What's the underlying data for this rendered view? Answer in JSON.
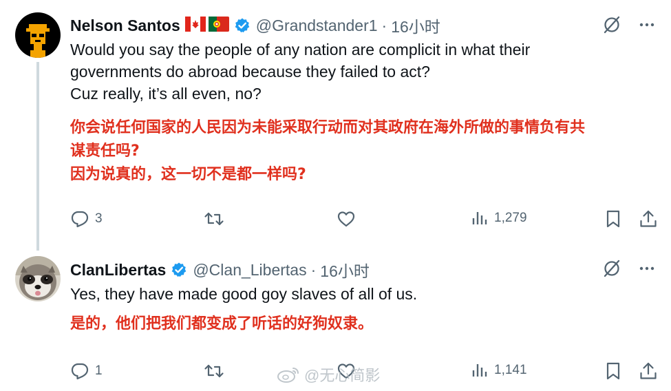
{
  "tweets": [
    {
      "name": "Nelson Santos",
      "handle": "@Grandstander1",
      "separator": "·",
      "time": "16小时",
      "text_lines": [
        "Would you say the people of any nation are complicit in what their",
        "governments do abroad because they failed to act?",
        "Cuz really, it’s all even, no?"
      ],
      "translation_lines": [
        "你会说任何国家的人民因为未能采取行动而对其政府在海外所做的事情负有共",
        "谋责任吗?",
        "因为说真的，这一切不是都一样吗?"
      ],
      "replies": "3",
      "retweets": "",
      "likes": "",
      "views": "1,279"
    },
    {
      "name": "ClanLibertas",
      "handle": "@Clan_Libertas",
      "separator": "·",
      "time": "16小时",
      "text_lines": [
        "Yes, they have made good goy slaves of all of us."
      ],
      "translation_lines": [
        "是的，他们把我们都变成了听话的好狗奴隶。"
      ],
      "replies": "1",
      "retweets": "",
      "likes": "",
      "views": "1,141"
    }
  ],
  "watermark": "@无心简影",
  "colors": {
    "verified": "#1d9bf0",
    "secondary_text": "#536471",
    "translation": "#e0301e",
    "thread_line": "#cfd9de"
  },
  "icons": [
    "reply-icon",
    "retweet-icon",
    "like-icon",
    "views-icon",
    "bookmark-icon",
    "share-icon",
    "grok-icon",
    "more-icon",
    "verified-badge-icon",
    "weibo-icon"
  ]
}
